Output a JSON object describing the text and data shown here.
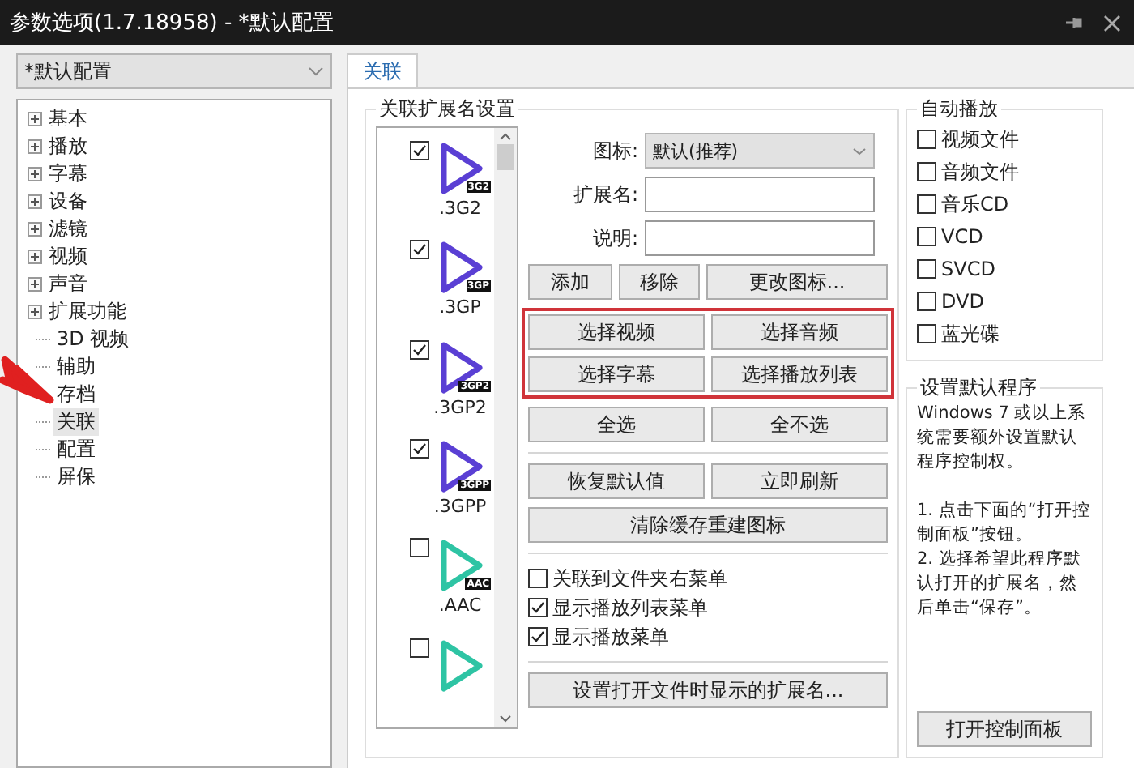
{
  "window": {
    "title": "参数选项(1.7.18958) - *默认配置"
  },
  "profile_select": {
    "value": "*默认配置"
  },
  "tree": [
    {
      "label": "基本",
      "kind": "folder",
      "selected": false
    },
    {
      "label": "播放",
      "kind": "folder",
      "selected": false
    },
    {
      "label": "字幕",
      "kind": "folder",
      "selected": false
    },
    {
      "label": "设备",
      "kind": "folder",
      "selected": false
    },
    {
      "label": "滤镜",
      "kind": "folder",
      "selected": false
    },
    {
      "label": "视频",
      "kind": "folder",
      "selected": false
    },
    {
      "label": "声音",
      "kind": "folder",
      "selected": false
    },
    {
      "label": "扩展功能",
      "kind": "folder",
      "selected": false
    },
    {
      "label": "3D 视频",
      "kind": "leaf",
      "selected": false
    },
    {
      "label": "辅助",
      "kind": "leaf",
      "selected": false
    },
    {
      "label": "存档",
      "kind": "leaf",
      "selected": false
    },
    {
      "label": "关联",
      "kind": "leaf",
      "selected": true
    },
    {
      "label": "配置",
      "kind": "leaf",
      "selected": false
    },
    {
      "label": "屏保",
      "kind": "leaf",
      "selected": false
    }
  ],
  "tabs": [
    {
      "label": "关联",
      "selected": true
    }
  ],
  "association": {
    "title": "关联扩展名设置",
    "extensions": [
      {
        "label": ".3G2",
        "badge": "3G2",
        "checked": true,
        "color": "#5a3fd4"
      },
      {
        "label": ".3GP",
        "badge": "3GP",
        "checked": true,
        "color": "#5a3fd4"
      },
      {
        "label": ".3GP2",
        "badge": "3GP2",
        "checked": true,
        "color": "#5a3fd4"
      },
      {
        "label": ".3GPP",
        "badge": "3GPP",
        "checked": true,
        "color": "#5a3fd4"
      },
      {
        "label": ".AAC",
        "badge": "AAC",
        "checked": false,
        "color": "#2ec4a4"
      },
      {
        "checked": false,
        "color": "#2ec4a4"
      }
    ],
    "icon_label": "图标:",
    "icon_select": "默认(推荐)",
    "ext_label": "扩展名:",
    "desc_label": "说明:",
    "edit_buttons": [
      "添加",
      "移除",
      "更改图标..."
    ],
    "select_buttons": [
      "选择视频",
      "选择音频",
      "选择字幕",
      "选择播放列表"
    ],
    "all_buttons": [
      "全选",
      "全不选"
    ],
    "reset_buttons": [
      "恢复默认值",
      "立即刷新"
    ],
    "rebuild_button": "清除缓存重建图标",
    "options": [
      {
        "label": "关联到文件夹右菜单",
        "checked": false
      },
      {
        "label": "显示播放列表菜单",
        "checked": true
      },
      {
        "label": "显示播放菜单",
        "checked": true
      }
    ],
    "open_ext_button": "设置打开文件时显示的扩展名..."
  },
  "autoplay": {
    "title": "自动播放",
    "items": [
      {
        "label": "视频文件",
        "checked": false
      },
      {
        "label": "音频文件",
        "checked": false
      },
      {
        "label": "音乐CD",
        "checked": false
      },
      {
        "label": "VCD",
        "checked": false
      },
      {
        "label": "SVCD",
        "checked": false
      },
      {
        "label": "DVD",
        "checked": false
      },
      {
        "label": "蓝光碟",
        "checked": false
      }
    ]
  },
  "default_program": {
    "title": "设置默认程序",
    "text": "Windows 7 或以上系统需要额外设置默认程序控制权。\n\n1. 点击下面的“打开控制面板”按钮。\n2. 选择希望此程序默认打开的扩展名，然后单击“保存”。",
    "button": "打开控制面板"
  }
}
